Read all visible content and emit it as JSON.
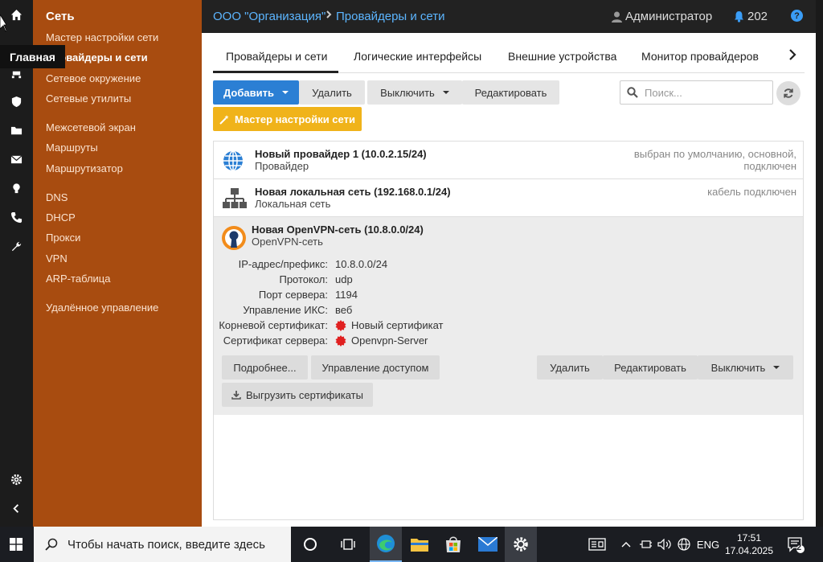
{
  "tooltip": "Главная",
  "sidebar": {
    "title": "Сеть",
    "items": [
      {
        "label": "Мастер настройки сети"
      },
      {
        "label": "Провайдеры и сети"
      },
      {
        "label": "Сетевое окружение"
      },
      {
        "label": "Сетевые утилиты"
      },
      {
        "label": "Межсетевой экран"
      },
      {
        "label": "Маршруты"
      },
      {
        "label": "Маршрутизатор"
      },
      {
        "label": "DNS"
      },
      {
        "label": "DHCP"
      },
      {
        "label": "Прокси"
      },
      {
        "label": "VPN"
      },
      {
        "label": "ARP-таблица"
      },
      {
        "label": "Удалённое управление"
      }
    ]
  },
  "header": {
    "breadcrumb": [
      "ООО \"Организация\"",
      "Провайдеры и сети"
    ],
    "user": "Администратор",
    "notifications": "202"
  },
  "tabs": [
    "Провайдеры и сети",
    "Логические интерфейсы",
    "Внешние устройства",
    "Монитор провайдеров"
  ],
  "toolbar": {
    "add": "Добавить",
    "delete": "Удалить",
    "disable": "Выключить",
    "edit": "Редактировать",
    "wizard": "Мастер настройки сети",
    "search_placeholder": "Поиск..."
  },
  "rows": [
    {
      "title": "Новый провайдер 1 (10.0.2.15/24)",
      "subtitle": "Провайдер",
      "status_line1": "выбран по умолчанию, основной,",
      "status_line2": "подключен"
    },
    {
      "title": "Новая локальная сеть (192.168.0.1/24)",
      "subtitle": "Локальная сеть",
      "status_line1": "кабель подключен"
    },
    {
      "title": "Новая OpenVPN-сеть (10.8.0.0/24)",
      "subtitle": "OpenVPN-сеть"
    }
  ],
  "details": [
    {
      "label": "IP-адрес/префикс:",
      "value": "10.8.0.0/24"
    },
    {
      "label": "Протокол:",
      "value": "udp"
    },
    {
      "label": "Порт сервера:",
      "value": "1194"
    },
    {
      "label": "Управление ИКС:",
      "value": "веб"
    },
    {
      "label": "Корневой сертификат:",
      "value": "Новый сертификат"
    },
    {
      "label": "Сертификат сервера:",
      "value": "Openvpn-Server"
    }
  ],
  "row_actions": {
    "more": "Подробнее...",
    "access": "Управление доступом",
    "delete": "Удалить",
    "edit": "Редактировать",
    "disable": "Выключить",
    "download": "Выгрузить сертификаты"
  },
  "taskbar": {
    "search_placeholder": "Чтобы начать поиск, введите здесь",
    "lang": "ENG",
    "time": "17:51",
    "date": "17.04.2025",
    "notif_count": "2"
  },
  "colors": {
    "accent": "#2b7fd4",
    "sidebar": "#a84c10",
    "wizard": "#f0b31a",
    "cert": "#e02020"
  }
}
